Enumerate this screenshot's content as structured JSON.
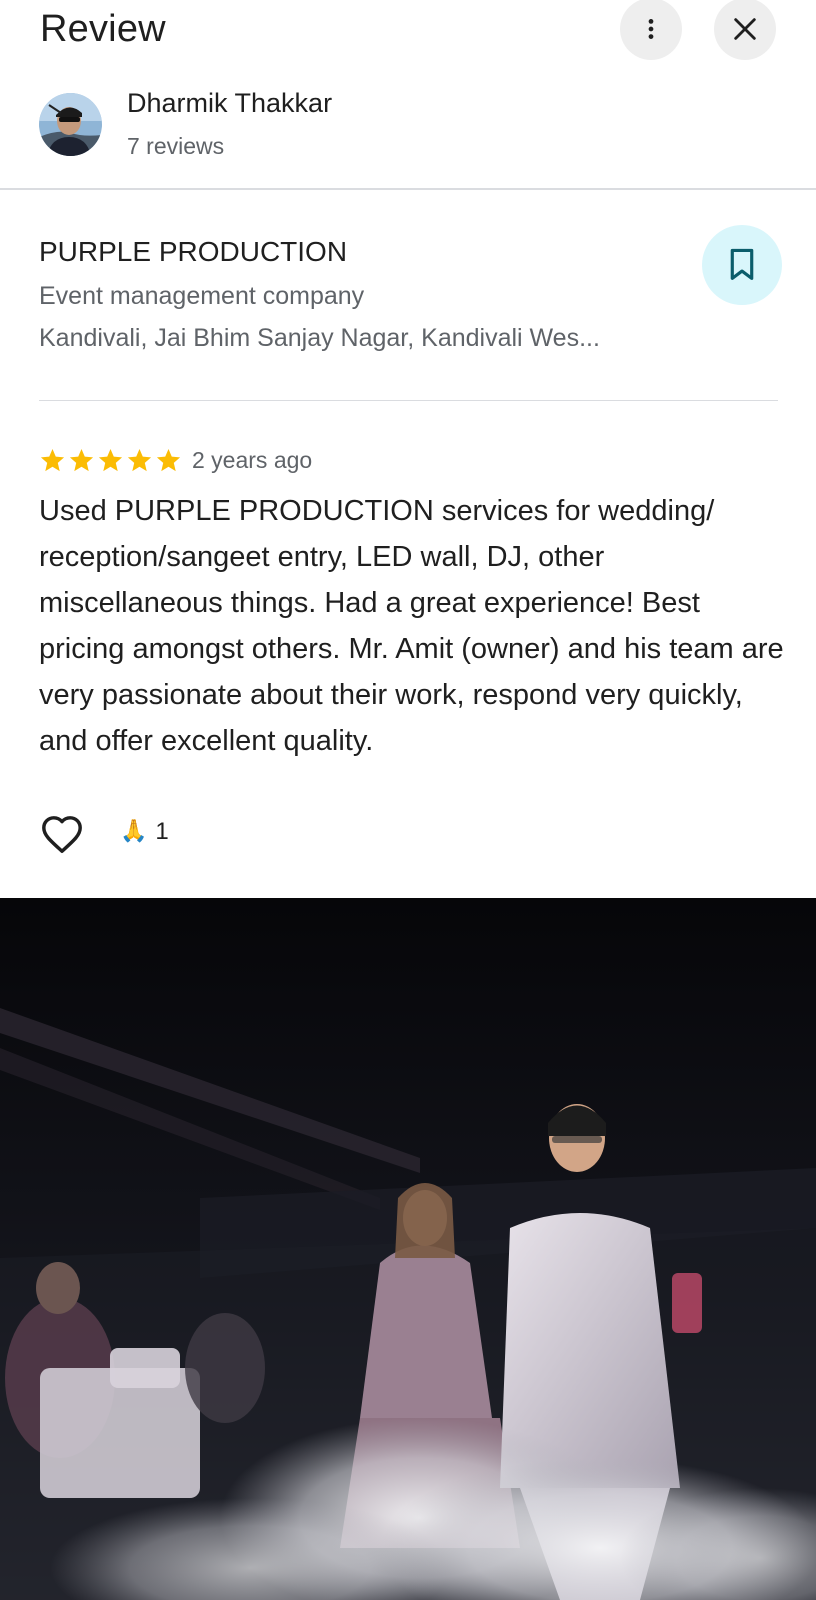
{
  "header": {
    "title": "Review",
    "more_icon": "more-vertical-icon",
    "close_icon": "close-icon"
  },
  "reviewer": {
    "name": "Dharmik Thakkar",
    "reviews_count": "7 reviews"
  },
  "place": {
    "name": "PURPLE PRODUCTION",
    "category": "Event management company",
    "address": "Kandivali, Jai Bhim Sanjay Nagar, Kandivali Wes...",
    "save_icon": "bookmark-icon"
  },
  "review": {
    "rating": 5,
    "max_rating": 5,
    "time": "2 years ago",
    "text": "Used PURPLE PRODUCTION services for wedding/ reception/sangeet entry, LED wall, DJ, other miscellaneous things. Had a great experience! Best pricing amongst others. Mr. Amit (owner) and his team are very passionate about their work, respond very quickly, and offer excellent quality."
  },
  "reactions": {
    "like_icon": "heart-outline-icon",
    "emoji": "🙏",
    "count": "1"
  },
  "colors": {
    "star": "#fbbc04",
    "save_bg": "#d9f6fb",
    "save_icon": "#0b5d6b",
    "divider": "#dadce0"
  }
}
